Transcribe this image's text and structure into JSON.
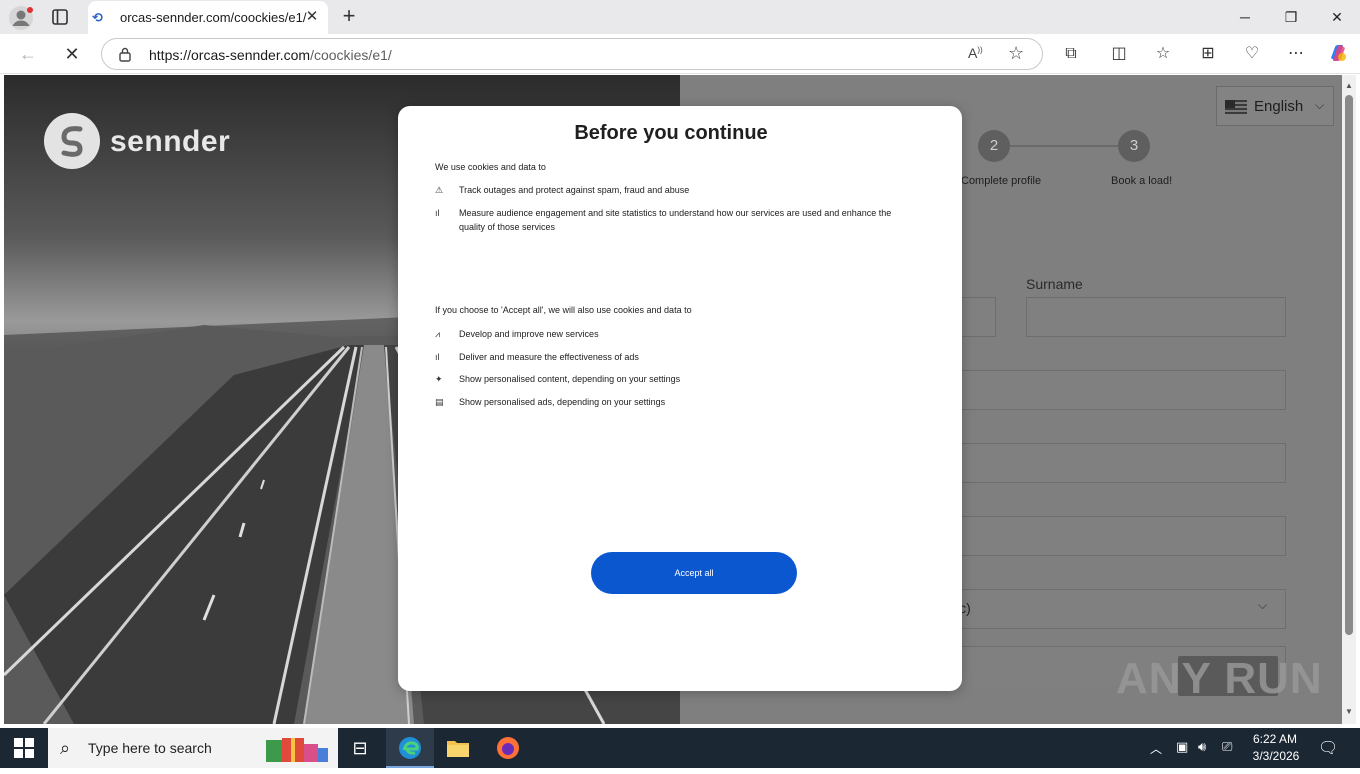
{
  "browser": {
    "tab_title": "orcas-sennder.com/coockies/e1/",
    "url_host": "https://orcas-sennder.com",
    "url_path": "/coockies/e1/"
  },
  "page": {
    "logo_text": "sennder",
    "language": "English",
    "steps": [
      {
        "number": "2",
        "label": "Complete profile"
      },
      {
        "number": "3",
        "label": "Book a load!"
      }
    ],
    "surname_label": "Surname",
    "select_partial_text": "ic)"
  },
  "consent": {
    "title": "Before you continue",
    "intro": "We use cookies and data to",
    "items": [
      {
        "icon": "warning-icon",
        "text": "Track outages and protect against spam, fraud and abuse"
      },
      {
        "icon": "bar-chart-icon",
        "text": "Measure audience engagement and site statistics to understand how our services are used and enhance the quality of those services"
      }
    ],
    "accept_intro": "If you choose to 'Accept all', we will also use cookies and data to",
    "accept_items": [
      {
        "icon": "trend-icon",
        "text": "Develop and improve new services"
      },
      {
        "icon": "bar-chart-icon",
        "text": "Deliver and measure the effectiveness of ads"
      },
      {
        "icon": "sparkle-icon",
        "text": "Show personalised content, depending on your settings"
      },
      {
        "icon": "ad-icon",
        "text": "Show personalised ads, depending on your settings"
      }
    ],
    "accept_button": "Accept all",
    "accent_color": "#0b57d0"
  },
  "watermark": "ANY RUN",
  "taskbar": {
    "search_placeholder": "Type here to search",
    "time": "6:22 AM",
    "date": "3/3/2026"
  }
}
